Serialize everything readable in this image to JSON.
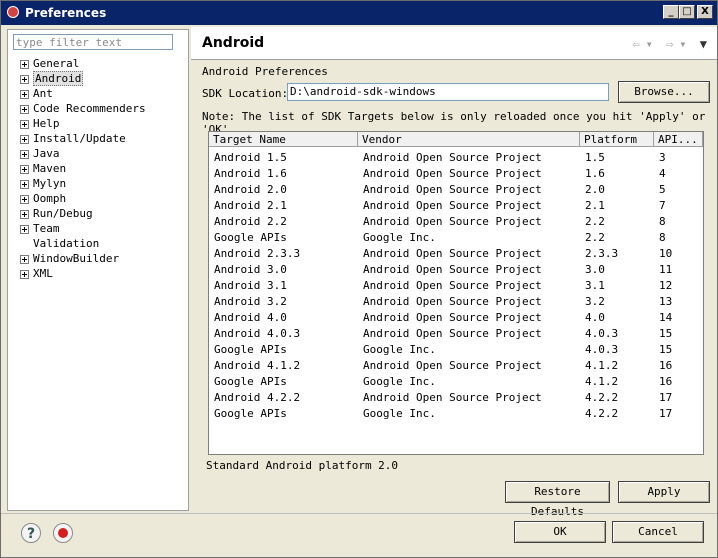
{
  "window": {
    "title": "Preferences",
    "controls": {
      "minimize": "_",
      "maximize": "□",
      "close": "X"
    }
  },
  "left": {
    "filter_placeholder": "type filter text",
    "tree": [
      {
        "label": "General",
        "expandable": true
      },
      {
        "label": "Android",
        "expandable": true,
        "selected": true
      },
      {
        "label": "Ant",
        "expandable": true
      },
      {
        "label": "Code Recommenders",
        "expandable": true
      },
      {
        "label": "Help",
        "expandable": true
      },
      {
        "label": "Install/Update",
        "expandable": true
      },
      {
        "label": "Java",
        "expandable": true
      },
      {
        "label": "Maven",
        "expandable": true
      },
      {
        "label": "Mylyn",
        "expandable": true
      },
      {
        "label": "Oomph",
        "expandable": true
      },
      {
        "label": "Run/Debug",
        "expandable": true
      },
      {
        "label": "Team",
        "expandable": true
      },
      {
        "label": "Validation",
        "expandable": false
      },
      {
        "label": "WindowBuilder",
        "expandable": true
      },
      {
        "label": "XML",
        "expandable": true
      }
    ]
  },
  "page": {
    "title": "Android",
    "section_title": "Android Preferences",
    "sdk_label": "SDK Location:",
    "sdk_value": "D:\\android-sdk-windows",
    "browse_label": "Browse...",
    "note": "Note: The list of SDK Targets below is only reloaded once you hit 'Apply' or 'OK'.",
    "table": {
      "columns": [
        "Target Name",
        "Vendor",
        "Platform",
        "API..."
      ],
      "rows": [
        [
          "Android 1.5",
          "Android Open Source Project",
          "1.5",
          "3"
        ],
        [
          "Android 1.6",
          "Android Open Source Project",
          "1.6",
          "4"
        ],
        [
          "Android 2.0",
          "Android Open Source Project",
          "2.0",
          "5"
        ],
        [
          "Android 2.1",
          "Android Open Source Project",
          "2.1",
          "7"
        ],
        [
          "Android 2.2",
          "Android Open Source Project",
          "2.2",
          "8"
        ],
        [
          "Google APIs",
          "Google Inc.",
          "2.2",
          "8"
        ],
        [
          "Android 2.3.3",
          "Android Open Source Project",
          "2.3.3",
          "10"
        ],
        [
          "Android 3.0",
          "Android Open Source Project",
          "3.0",
          "11"
        ],
        [
          "Android 3.1",
          "Android Open Source Project",
          "3.1",
          "12"
        ],
        [
          "Android 3.2",
          "Android Open Source Project",
          "3.2",
          "13"
        ],
        [
          "Android 4.0",
          "Android Open Source Project",
          "4.0",
          "14"
        ],
        [
          "Android 4.0.3",
          "Android Open Source Project",
          "4.0.3",
          "15"
        ],
        [
          "Google APIs",
          "Google Inc.",
          "4.0.3",
          "15"
        ],
        [
          "Android 4.1.2",
          "Android Open Source Project",
          "4.1.2",
          "16"
        ],
        [
          "Google APIs",
          "Google Inc.",
          "4.1.2",
          "16"
        ],
        [
          "Android 4.2.2",
          "Android Open Source Project",
          "4.2.2",
          "17"
        ],
        [
          "Google APIs",
          "Google Inc.",
          "4.2.2",
          "17"
        ]
      ]
    },
    "status": "Standard Android platform 2.0",
    "restore_label": "Restore Defaults",
    "apply_label": "Apply"
  },
  "footer": {
    "ok_label": "OK",
    "cancel_label": "Cancel",
    "help_glyph": "?"
  }
}
